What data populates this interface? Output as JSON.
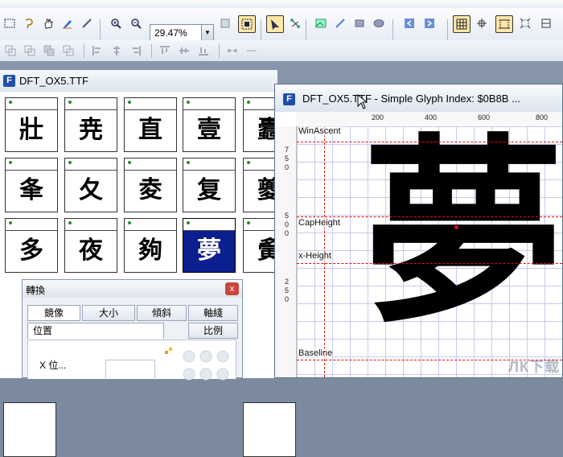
{
  "toolbar": {
    "zoom_value": "29.47%",
    "zoom_dropdown_icon": "chevron-down-icon"
  },
  "font_window": {
    "title": "DFT_OX5.TTF",
    "title_icon": "F",
    "glyphs": [
      "壯",
      "尭",
      "直",
      "壹",
      "蠹",
      "夆",
      "夂",
      "夌",
      "复",
      "夔",
      "多",
      "夜",
      "夠",
      "夢",
      "夤"
    ],
    "selected_index": 13,
    "colors": {
      "selected": "#0b1f8e",
      "dot": "#2c8a2c"
    }
  },
  "transform_dialog": {
    "title": "轉換",
    "close_label": "x",
    "tabs": [
      "鏡像",
      "大小",
      "傾斜",
      "軸綫"
    ],
    "tabs_row2": [
      "位置",
      "比例"
    ],
    "x_label": "X 位..."
  },
  "glyph_window": {
    "title": "DFT_OX5.TTF - Simple Glyph Index: $0B8B ...",
    "title_icon": "F",
    "ruler_top": [
      "200",
      "400",
      "600",
      "800"
    ],
    "ruler_left_groups": [
      "7 5 0",
      "5 0 0",
      "2 5 0"
    ],
    "metrics": {
      "winascent": "WinAscent",
      "capheight": "CapHeight",
      "xheight": "x-Height",
      "baseline": "Baseline"
    },
    "glyph": "夢",
    "metric_color": "#dd1111"
  },
  "watermark": "ЛК下载"
}
